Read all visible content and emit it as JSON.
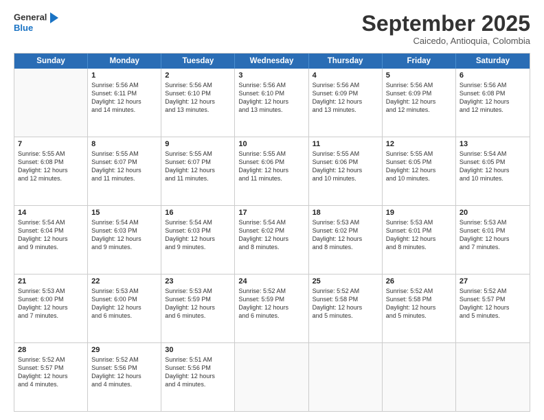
{
  "header": {
    "logo_line1": "General",
    "logo_line2": "Blue",
    "month_title": "September 2025",
    "subtitle": "Caicedo, Antioquia, Colombia"
  },
  "weekdays": [
    "Sunday",
    "Monday",
    "Tuesday",
    "Wednesday",
    "Thursday",
    "Friday",
    "Saturday"
  ],
  "rows": [
    [
      {
        "day": "",
        "lines": []
      },
      {
        "day": "1",
        "lines": [
          "Sunrise: 5:56 AM",
          "Sunset: 6:11 PM",
          "Daylight: 12 hours",
          "and 14 minutes."
        ]
      },
      {
        "day": "2",
        "lines": [
          "Sunrise: 5:56 AM",
          "Sunset: 6:10 PM",
          "Daylight: 12 hours",
          "and 13 minutes."
        ]
      },
      {
        "day": "3",
        "lines": [
          "Sunrise: 5:56 AM",
          "Sunset: 6:10 PM",
          "Daylight: 12 hours",
          "and 13 minutes."
        ]
      },
      {
        "day": "4",
        "lines": [
          "Sunrise: 5:56 AM",
          "Sunset: 6:09 PM",
          "Daylight: 12 hours",
          "and 13 minutes."
        ]
      },
      {
        "day": "5",
        "lines": [
          "Sunrise: 5:56 AM",
          "Sunset: 6:09 PM",
          "Daylight: 12 hours",
          "and 12 minutes."
        ]
      },
      {
        "day": "6",
        "lines": [
          "Sunrise: 5:56 AM",
          "Sunset: 6:08 PM",
          "Daylight: 12 hours",
          "and 12 minutes."
        ]
      }
    ],
    [
      {
        "day": "7",
        "lines": [
          "Sunrise: 5:55 AM",
          "Sunset: 6:08 PM",
          "Daylight: 12 hours",
          "and 12 minutes."
        ]
      },
      {
        "day": "8",
        "lines": [
          "Sunrise: 5:55 AM",
          "Sunset: 6:07 PM",
          "Daylight: 12 hours",
          "and 11 minutes."
        ]
      },
      {
        "day": "9",
        "lines": [
          "Sunrise: 5:55 AM",
          "Sunset: 6:07 PM",
          "Daylight: 12 hours",
          "and 11 minutes."
        ]
      },
      {
        "day": "10",
        "lines": [
          "Sunrise: 5:55 AM",
          "Sunset: 6:06 PM",
          "Daylight: 12 hours",
          "and 11 minutes."
        ]
      },
      {
        "day": "11",
        "lines": [
          "Sunrise: 5:55 AM",
          "Sunset: 6:06 PM",
          "Daylight: 12 hours",
          "and 10 minutes."
        ]
      },
      {
        "day": "12",
        "lines": [
          "Sunrise: 5:55 AM",
          "Sunset: 6:05 PM",
          "Daylight: 12 hours",
          "and 10 minutes."
        ]
      },
      {
        "day": "13",
        "lines": [
          "Sunrise: 5:54 AM",
          "Sunset: 6:05 PM",
          "Daylight: 12 hours",
          "and 10 minutes."
        ]
      }
    ],
    [
      {
        "day": "14",
        "lines": [
          "Sunrise: 5:54 AM",
          "Sunset: 6:04 PM",
          "Daylight: 12 hours",
          "and 9 minutes."
        ]
      },
      {
        "day": "15",
        "lines": [
          "Sunrise: 5:54 AM",
          "Sunset: 6:03 PM",
          "Daylight: 12 hours",
          "and 9 minutes."
        ]
      },
      {
        "day": "16",
        "lines": [
          "Sunrise: 5:54 AM",
          "Sunset: 6:03 PM",
          "Daylight: 12 hours",
          "and 9 minutes."
        ]
      },
      {
        "day": "17",
        "lines": [
          "Sunrise: 5:54 AM",
          "Sunset: 6:02 PM",
          "Daylight: 12 hours",
          "and 8 minutes."
        ]
      },
      {
        "day": "18",
        "lines": [
          "Sunrise: 5:53 AM",
          "Sunset: 6:02 PM",
          "Daylight: 12 hours",
          "and 8 minutes."
        ]
      },
      {
        "day": "19",
        "lines": [
          "Sunrise: 5:53 AM",
          "Sunset: 6:01 PM",
          "Daylight: 12 hours",
          "and 8 minutes."
        ]
      },
      {
        "day": "20",
        "lines": [
          "Sunrise: 5:53 AM",
          "Sunset: 6:01 PM",
          "Daylight: 12 hours",
          "and 7 minutes."
        ]
      }
    ],
    [
      {
        "day": "21",
        "lines": [
          "Sunrise: 5:53 AM",
          "Sunset: 6:00 PM",
          "Daylight: 12 hours",
          "and 7 minutes."
        ]
      },
      {
        "day": "22",
        "lines": [
          "Sunrise: 5:53 AM",
          "Sunset: 6:00 PM",
          "Daylight: 12 hours",
          "and 6 minutes."
        ]
      },
      {
        "day": "23",
        "lines": [
          "Sunrise: 5:53 AM",
          "Sunset: 5:59 PM",
          "Daylight: 12 hours",
          "and 6 minutes."
        ]
      },
      {
        "day": "24",
        "lines": [
          "Sunrise: 5:52 AM",
          "Sunset: 5:59 PM",
          "Daylight: 12 hours",
          "and 6 minutes."
        ]
      },
      {
        "day": "25",
        "lines": [
          "Sunrise: 5:52 AM",
          "Sunset: 5:58 PM",
          "Daylight: 12 hours",
          "and 5 minutes."
        ]
      },
      {
        "day": "26",
        "lines": [
          "Sunrise: 5:52 AM",
          "Sunset: 5:58 PM",
          "Daylight: 12 hours",
          "and 5 minutes."
        ]
      },
      {
        "day": "27",
        "lines": [
          "Sunrise: 5:52 AM",
          "Sunset: 5:57 PM",
          "Daylight: 12 hours",
          "and 5 minutes."
        ]
      }
    ],
    [
      {
        "day": "28",
        "lines": [
          "Sunrise: 5:52 AM",
          "Sunset: 5:57 PM",
          "Daylight: 12 hours",
          "and 4 minutes."
        ]
      },
      {
        "day": "29",
        "lines": [
          "Sunrise: 5:52 AM",
          "Sunset: 5:56 PM",
          "Daylight: 12 hours",
          "and 4 minutes."
        ]
      },
      {
        "day": "30",
        "lines": [
          "Sunrise: 5:51 AM",
          "Sunset: 5:56 PM",
          "Daylight: 12 hours",
          "and 4 minutes."
        ]
      },
      {
        "day": "",
        "lines": []
      },
      {
        "day": "",
        "lines": []
      },
      {
        "day": "",
        "lines": []
      },
      {
        "day": "",
        "lines": []
      }
    ]
  ]
}
